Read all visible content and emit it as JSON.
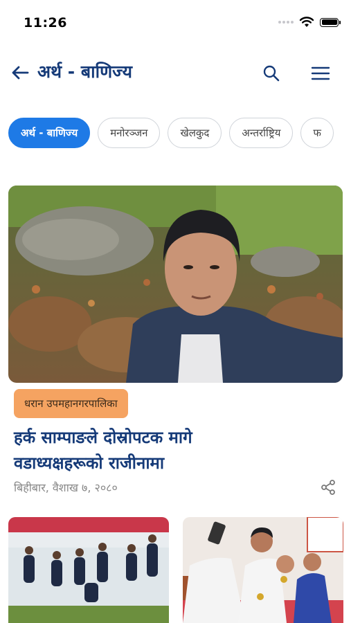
{
  "status_bar": {
    "time": "11:26"
  },
  "header": {
    "title": "अर्थ - बाणिज्य"
  },
  "icons": {
    "back": "back-arrow-icon",
    "search": "search-icon",
    "menu": "hamburger-menu-icon",
    "share": "share-icon"
  },
  "categories": [
    {
      "label": "अर्थ - बाणिज्य",
      "active": true
    },
    {
      "label": "मनोरञ्जन",
      "active": false
    },
    {
      "label": "खेलकुद",
      "active": false
    },
    {
      "label": "अन्तर्राष्ट्रिय",
      "active": false
    },
    {
      "label": "फ",
      "active": false
    }
  ],
  "featured": {
    "tag": "धरान उपमहानगरपालिका",
    "headline_line1": "हर्क साम्पाङले दोस्रोपटक मागे",
    "headline_line2": "वडाध्यक्षहरूको राजीनामा",
    "date": "बिहीबार, वैशाख ७, २०८०"
  },
  "colors": {
    "accent": "#1e7ae6",
    "title": "#153a78",
    "badge": "#f5a361"
  }
}
